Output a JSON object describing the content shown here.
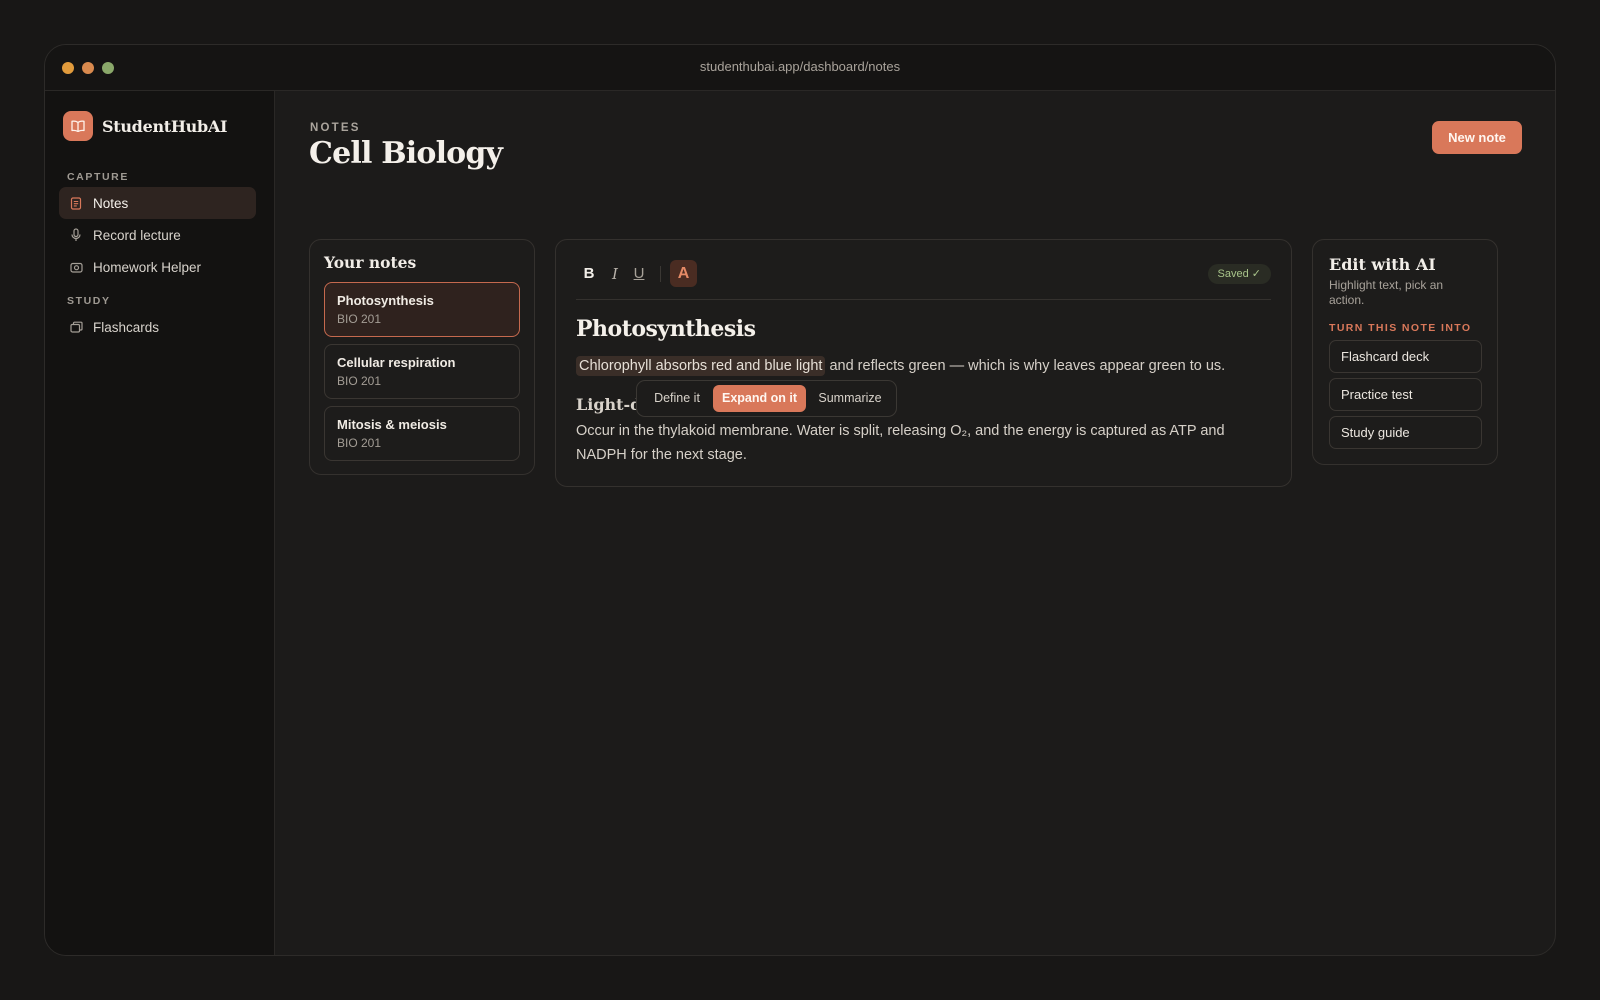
{
  "browser": {
    "url": "studenthubai.app/dashboard/notes"
  },
  "sidebar": {
    "brand": "StudentHubAI",
    "sections": [
      {
        "label": "CAPTURE",
        "items": [
          {
            "label": "Notes",
            "icon": "document-icon",
            "active": true
          },
          {
            "label": "Record lecture",
            "icon": "microphone-icon",
            "active": false
          },
          {
            "label": "Homework Helper",
            "icon": "camera-icon",
            "active": false
          }
        ]
      },
      {
        "label": "STUDY",
        "items": [
          {
            "label": "Flashcards",
            "icon": "cards-icon",
            "active": false
          }
        ]
      }
    ]
  },
  "header": {
    "eyebrow": "NOTES",
    "title": "Cell Biology",
    "new_note_label": "New note"
  },
  "notes_list": {
    "title": "Your notes",
    "items": [
      {
        "title": "Photosynthesis",
        "course": "BIO 201",
        "active": true
      },
      {
        "title": "Cellular respiration",
        "course": "BIO 201",
        "active": false
      },
      {
        "title": "Mitosis & meiosis",
        "course": "BIO 201",
        "active": false
      }
    ]
  },
  "editor": {
    "toolbar": {
      "bold": "B",
      "italic": "I",
      "underline": "U",
      "ai_format": "A"
    },
    "saved_status": "Saved ✓",
    "doc_title": "Photosynthesis",
    "highlighted_text": "Chlorophyll absorbs red and blue light",
    "paragraph1_rest": " and reflects green — which is why leaves appear green to us.",
    "subheading": "Light-d",
    "paragraph2": "Occur in the thylakoid membrane. Water is split, releasing O₂, and the energy is captured as ATP and NADPH for the next stage.",
    "popover": {
      "define": "Define it",
      "expand": "Expand on it",
      "summarize": "Summarize"
    }
  },
  "ai_panel": {
    "title": "Edit with AI",
    "subtitle": "Highlight text, pick an action.",
    "section_label": "TURN THIS NOTE INTO",
    "actions": [
      "Flashcard deck",
      "Practice test",
      "Study guide"
    ]
  },
  "colors": {
    "accent": "#d9785a",
    "background": "#181716",
    "saved_green": "#a8c48a"
  }
}
